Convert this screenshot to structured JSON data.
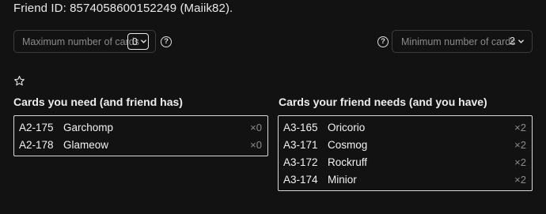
{
  "header": {
    "friend_id_text": "Friend ID: 8574058600152249 (Maiik82)."
  },
  "filters": {
    "max_cards": {
      "label": "Maximum number of cards",
      "value": "0",
      "icon": "chevron-down-icon"
    },
    "min_cards": {
      "label": "Minimum number of cards",
      "value": "2",
      "icon": "chevron-down-icon"
    },
    "help_glyph": "?"
  },
  "favorite": {
    "icon": "star-outline-icon"
  },
  "sections": {
    "you_need": {
      "title": "Cards you need (and friend has)",
      "cards": [
        {
          "code": "A2-175",
          "name": "Garchomp",
          "qty": "×0"
        },
        {
          "code": "A2-178",
          "name": "Glameow",
          "qty": "×0"
        }
      ]
    },
    "friend_needs": {
      "title": "Cards your friend needs (and you have)",
      "cards": [
        {
          "code": "A3-165",
          "name": "Oricorio",
          "qty": "×2"
        },
        {
          "code": "A3-171",
          "name": "Cosmog",
          "qty": "×2"
        },
        {
          "code": "A3-172",
          "name": "Rockruff",
          "qty": "×2"
        },
        {
          "code": "A3-174",
          "name": "Minior",
          "qty": "×2"
        }
      ]
    }
  }
}
